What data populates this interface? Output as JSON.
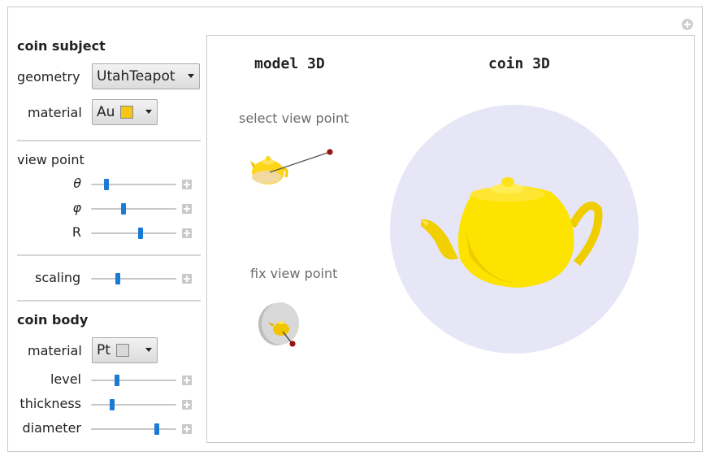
{
  "panel": {
    "coin_subject": {
      "title": "coin subject",
      "geometry_label": "geometry",
      "geometry_value": "UtahTeapot",
      "material_label": "material",
      "material_value": "Au",
      "material_color": "#f5c518"
    },
    "view_point": {
      "title": "view point",
      "sliders": [
        {
          "label": "θ",
          "value": 0.18
        },
        {
          "label": "φ",
          "value": 0.38
        },
        {
          "label": "R",
          "value": 0.58
        }
      ]
    },
    "scaling": {
      "label": "scaling",
      "value": 0.31
    },
    "coin_body": {
      "title": "coin body",
      "material_label": "material",
      "material_value": "Pt",
      "material_color": "#d9d9d9",
      "sliders": [
        {
          "label": "level",
          "value": 0.3
        },
        {
          "label": "thickness",
          "value": 0.25
        },
        {
          "label": "diameter",
          "value": 0.77
        }
      ]
    }
  },
  "viewer": {
    "model_title": "model 3D",
    "coin_title": "coin 3D",
    "select_caption": "select view point",
    "fix_caption": "fix view point"
  },
  "colors": {
    "gold": "#ffe000",
    "coin_disc": "#e6e6f7",
    "slider_thumb": "#1a7ad4",
    "probe": "#9b1010"
  }
}
